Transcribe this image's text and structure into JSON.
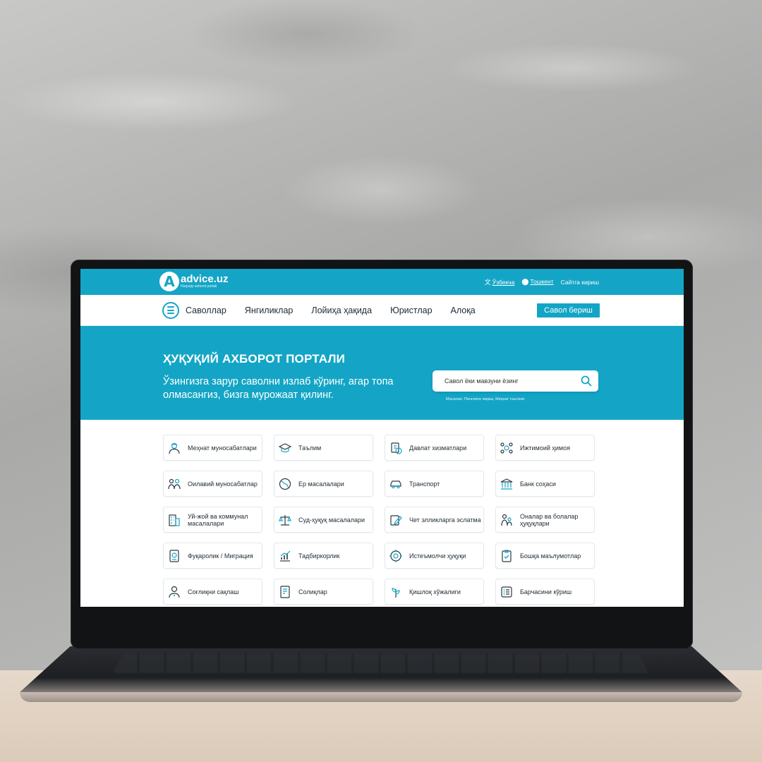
{
  "site": {
    "logo_letter": "A",
    "logo_name": "advice.uz",
    "logo_tagline": "Huquqiy axborot portali",
    "top_links": {
      "language": "Ўзбекча",
      "city": "Тошкент",
      "login": "Сайтга кириш"
    }
  },
  "nav": {
    "items": [
      "Саволлар",
      "Янгиликлар",
      "Лойиҳа ҳақида",
      "Юристлар",
      "Алоқа"
    ],
    "ask_button": "Савол бериш"
  },
  "hero": {
    "title": "ҲУҚУҚИЙ АХБОРОТ ПОРТАЛИ",
    "subtitle": "Ўзингизга зарур саволни излаб кўринг, агар топа олмасангиз, бизга мурожаат қилинг.",
    "search_placeholder": "Савол ёки мавзуни ёзинг",
    "search_hint": "Масалан: Пенсияга чиқиш, Меҳнат таътили"
  },
  "categories": [
    {
      "label": "Меҳнат муносабатлари",
      "icon": "worker-icon"
    },
    {
      "label": "Таълим",
      "icon": "graduation-cap-icon"
    },
    {
      "label": "Давлат хизматлари",
      "icon": "government-services-icon"
    },
    {
      "label": "Ижтимоий ҳимоя",
      "icon": "social-protection-icon"
    },
    {
      "label": "Оилавий муносабатлар",
      "icon": "family-icon"
    },
    {
      "label": "Ер масалалари",
      "icon": "globe-icon"
    },
    {
      "label": "Транспорт",
      "icon": "car-icon"
    },
    {
      "label": "Банк соҳаси",
      "icon": "bank-icon"
    },
    {
      "label": "Уй-жой ва коммунал масалалари",
      "icon": "apartment-icon"
    },
    {
      "label": "Суд-ҳуқуқ масалалари",
      "icon": "scales-icon"
    },
    {
      "label": "Чет элликларга эслатма",
      "icon": "note-pencil-icon"
    },
    {
      "label": "Оналар ва болалар ҳуқуқлари",
      "icon": "mother-child-icon"
    },
    {
      "label": "Фуқаролик / Миграция",
      "icon": "passport-icon"
    },
    {
      "label": "Тадбиркорлик",
      "icon": "growth-chart-icon"
    },
    {
      "label": "Истеъмолчи ҳуқуқи",
      "icon": "consumer-rights-icon"
    },
    {
      "label": "Бошқа маълумотлар",
      "icon": "clipboard-icon"
    },
    {
      "label": "Соғлиқни сақлаш",
      "icon": "doctor-icon"
    },
    {
      "label": "Солиқлар",
      "icon": "tax-document-icon"
    },
    {
      "label": "Қишлоқ хўжалиги",
      "icon": "agriculture-icon"
    },
    {
      "label": "Барчасини кўриш",
      "icon": "list-icon"
    }
  ],
  "colors": {
    "brand": "#14a5c6",
    "text": "#1d2b36"
  }
}
